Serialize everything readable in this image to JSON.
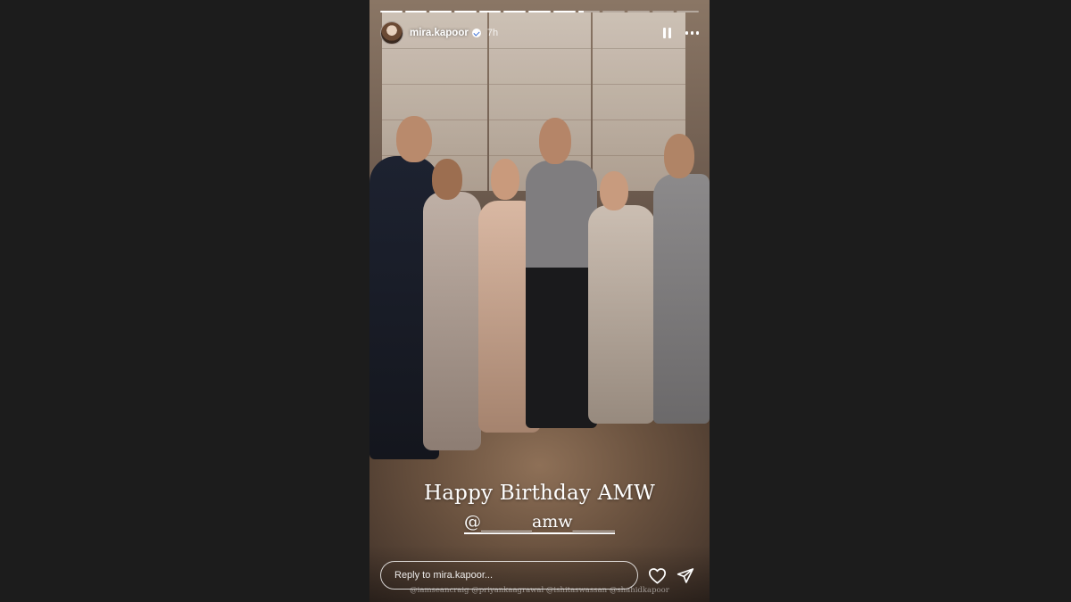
{
  "story": {
    "progress": [
      1,
      1,
      1,
      1,
      1,
      1,
      1,
      1,
      0.25,
      0,
      0,
      0,
      0
    ],
    "author": {
      "username": "mira.kapoor",
      "verified_icon": "verified-badge-icon",
      "posted_ago": "7h"
    },
    "controls": {
      "pause_icon": "pause-icon",
      "more_icon": "more-icon"
    },
    "caption": "Happy Birthday AMW",
    "mention": "@______amw_____",
    "tagged_handles": "@iamseancraig @priyankaagrawal @ishitaswassan @shahidkapoor",
    "reply": {
      "placeholder": "Reply to mira.kapoor..."
    },
    "actions": {
      "like_icon": "heart-icon",
      "share_icon": "send-icon"
    }
  },
  "colors": {
    "page_background": "#1c1c1c",
    "text": "#ffffff"
  }
}
